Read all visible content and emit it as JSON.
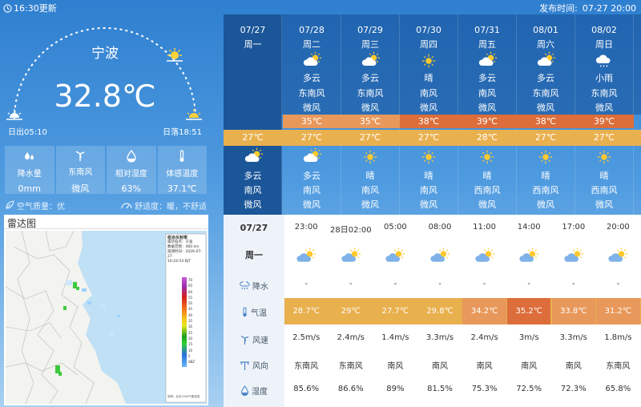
{
  "header": {
    "update_text": "16:30更新",
    "publish_label": "发布时间:",
    "publish_time": "07-27 20:00"
  },
  "current": {
    "city": "宁波",
    "temperature": "32.8℃",
    "sunrise": "日出05:10",
    "sunset": "日落18:51",
    "metrics": [
      {
        "label": "降水量",
        "value": "0mm",
        "icon": "raindrop-icon"
      },
      {
        "label": "东南风",
        "value": "微风",
        "icon": "wind-turbine-icon"
      },
      {
        "label": "相对湿度",
        "value": "63%",
        "icon": "humidity-icon"
      },
      {
        "label": "体感温度",
        "value": "37.1℃",
        "icon": "thermometer-icon"
      }
    ],
    "air_quality": "空气质量：优",
    "comfort": "舒适度：暖，不舒适"
  },
  "radar": {
    "title": "雷达图",
    "legend_title": "组合反射率",
    "legend_lines": [
      "雷达站点：宁波",
      "数据范围：460 km",
      "观测时间：2026-07-27",
      "16:24:54 BJT"
    ],
    "scale_values": [
      "70",
      "65",
      "60",
      "55",
      "50",
      "45",
      "40",
      "35",
      "30",
      "25",
      "20",
      "15",
      "10",
      "5",
      "dBZ"
    ],
    "footer": "说明：北京2026气象信息"
  },
  "forecast": [
    {
      "date": "07/27",
      "week": "周一",
      "day_weather": "",
      "day_icon": "",
      "day_wind_dir": "",
      "day_wind_speed": "",
      "high": "",
      "low": "27℃",
      "night_icon": "partly-cloudy-night-icon",
      "night_weather": "多云",
      "night_wind_dir": "南风",
      "night_wind_speed": "微风",
      "high_color": ""
    },
    {
      "date": "07/28",
      "week": "周二",
      "day_weather": "多云",
      "day_icon": "partly-cloudy-icon",
      "day_wind_dir": "东南风",
      "day_wind_speed": "微风",
      "high": "35℃",
      "low": "27℃",
      "night_icon": "partly-cloudy-night-icon",
      "night_weather": "多云",
      "night_wind_dir": "南风",
      "night_wind_speed": "微风",
      "high_color": "#e8985a"
    },
    {
      "date": "07/29",
      "week": "周三",
      "day_weather": "多云",
      "day_icon": "partly-cloudy-icon",
      "day_wind_dir": "东南风",
      "day_wind_speed": "微风",
      "high": "35℃",
      "low": "27℃",
      "night_icon": "sun-icon",
      "night_weather": "晴",
      "night_wind_dir": "南风",
      "night_wind_speed": "微风",
      "high_color": "#e8985a"
    },
    {
      "date": "07/30",
      "week": "周四",
      "day_weather": "晴",
      "day_icon": "sun-icon",
      "day_wind_dir": "南风",
      "day_wind_speed": "微风",
      "high": "38℃",
      "low": "27℃",
      "night_icon": "sun-icon",
      "night_weather": "晴",
      "night_wind_dir": "南风",
      "night_wind_speed": "微风",
      "high_color": "#dd6d3a"
    },
    {
      "date": "07/31",
      "week": "周五",
      "day_weather": "多云",
      "day_icon": "partly-cloudy-icon",
      "day_wind_dir": "南风",
      "day_wind_speed": "微风",
      "high": "39℃",
      "low": "28℃",
      "night_icon": "sun-icon",
      "night_weather": "晴",
      "night_wind_dir": "西南风",
      "night_wind_speed": "微风",
      "high_color": "#dd6d3a"
    },
    {
      "date": "08/01",
      "week": "周六",
      "day_weather": "多云",
      "day_icon": "partly-cloudy-icon",
      "day_wind_dir": "东南风",
      "day_wind_speed": "微风",
      "high": "38℃",
      "low": "27℃",
      "night_icon": "sun-icon",
      "night_weather": "晴",
      "night_wind_dir": "西南风",
      "night_wind_speed": "微风",
      "high_color": "#dd6d3a"
    },
    {
      "date": "08/02",
      "week": "周日",
      "day_weather": "小雨",
      "day_icon": "light-rain-icon",
      "day_wind_dir": "东南风",
      "day_wind_speed": "微风",
      "high": "39℃",
      "low": "27℃",
      "night_icon": "sun-icon",
      "night_weather": "晴",
      "night_wind_dir": "西南风",
      "night_wind_speed": "微风",
      "high_color": "#dd6d3a"
    }
  ],
  "hourly": {
    "date": "07/27",
    "week": "周一",
    "row_labels": {
      "rain": "降水",
      "temp": "气温",
      "wind_speed": "风速",
      "wind_dir": "风向",
      "humidity": "湿度"
    },
    "hours": [
      {
        "time": "23:00",
        "rain": "-",
        "temp": "28.7℃",
        "wind_speed": "2.5m/s",
        "wind_dir": "东南风",
        "humidity": "85.6%",
        "temp_color": "#e9b04e"
      },
      {
        "time": "28日02:00",
        "rain": "-",
        "temp": "29℃",
        "wind_speed": "2.4m/s",
        "wind_dir": "东南风",
        "humidity": "86.6%",
        "temp_color": "#e9b04e"
      },
      {
        "time": "05:00",
        "rain": "-",
        "temp": "27.7℃",
        "wind_speed": "1.4m/s",
        "wind_dir": "南风",
        "humidity": "89%",
        "temp_color": "#e9b04e"
      },
      {
        "time": "08:00",
        "rain": "-",
        "temp": "29.8℃",
        "wind_speed": "3.3m/s",
        "wind_dir": "南风",
        "humidity": "81.5%",
        "temp_color": "#e9b04e"
      },
      {
        "time": "11:00",
        "rain": "-",
        "temp": "34.2℃",
        "wind_speed": "2.4m/s",
        "wind_dir": "南风",
        "humidity": "75.3%",
        "temp_color": "#e8985a"
      },
      {
        "time": "14:00",
        "rain": "-",
        "temp": "35.2℃",
        "wind_speed": "3m/s",
        "wind_dir": "南风",
        "humidity": "72.5%",
        "temp_color": "#dd6d3a"
      },
      {
        "time": "17:00",
        "rain": "-",
        "temp": "33.8℃",
        "wind_speed": "3.3m/s",
        "wind_dir": "南风",
        "humidity": "72.3%",
        "temp_color": "#e8985a"
      },
      {
        "time": "20:00",
        "rain": "-",
        "temp": "31.2℃",
        "wind_speed": "1.8m/s",
        "wind_dir": "东南风",
        "humidity": "65.8%",
        "temp_color": "#e8985a"
      }
    ]
  }
}
